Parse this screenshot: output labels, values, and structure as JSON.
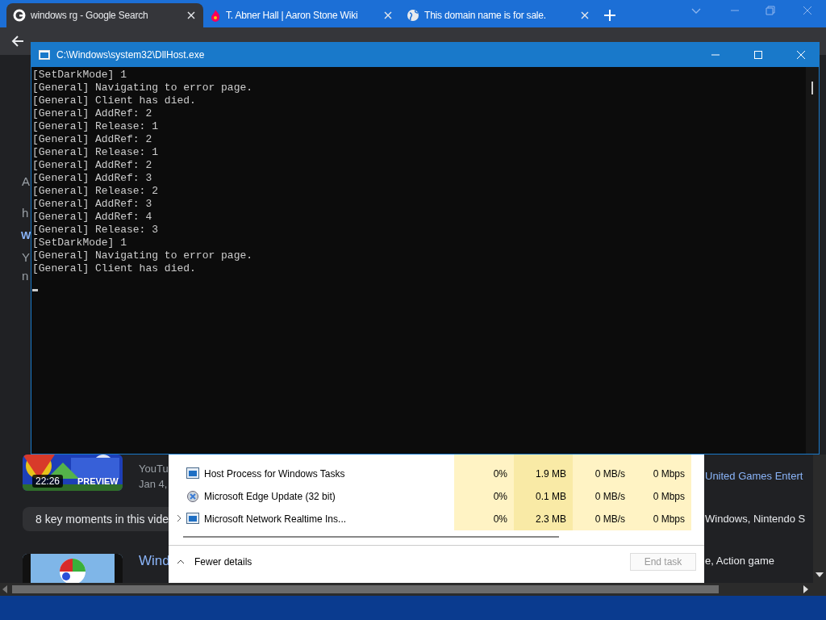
{
  "browser": {
    "tabs": [
      {
        "title": "windows rg - Google Search",
        "selected": true
      },
      {
        "title": "T. Abner Hall | Aaron Stone Wiki",
        "selected": false
      },
      {
        "title": "This domain name is for sale.",
        "selected": false
      }
    ],
    "page": {
      "left_fragments": [
        {
          "text": "A",
          "kind": "plain"
        },
        {
          "text": "h",
          "kind": "plain"
        },
        {
          "text": "W",
          "kind": "link"
        },
        {
          "text": "Y",
          "kind": "plain"
        },
        {
          "text": "n",
          "kind": "plain"
        }
      ],
      "video": {
        "duration": "22:26",
        "badge": "PREVIEW",
        "source": "YouTu",
        "date": "Jan 4,",
        "channel": "United Games Entert"
      },
      "key_moments": "8 key moments in this vide",
      "video_tags": "Windows, Nintendo S",
      "next_video": {
        "title": "Wind",
        "tags": "e, Action game"
      }
    }
  },
  "console": {
    "title": "C:\\Windows\\system32\\DllHost.exe",
    "lines": [
      "[SetDarkMode] 1",
      "[General] Navigating to error page.",
      "[General] Client has died.",
      "[General] AddRef: 2",
      "[General] Release: 1",
      "[General] AddRef: 2",
      "[General] Release: 1",
      "[General] AddRef: 2",
      "[General] AddRef: 3",
      "[General] Release: 2",
      "[General] AddRef: 3",
      "[General] AddRef: 4",
      "[General] Release: 3",
      "[SetDarkMode] 1",
      "[General] Navigating to error page.",
      "[General] Client has died."
    ]
  },
  "task_manager": {
    "rows": [
      {
        "name": "Host Process for Windows Tasks",
        "kind": "process",
        "cpu": "0%",
        "memory": "1.9 MB",
        "disk": "0 MB/s",
        "network": "0 Mbps"
      },
      {
        "name": "Microsoft Edge Update (32 bit)",
        "kind": "updater",
        "cpu": "0%",
        "memory": "0.1 MB",
        "disk": "0 MB/s",
        "network": "0 Mbps"
      },
      {
        "name": "Microsoft Network Realtime Ins...",
        "kind": "group",
        "cpu": "0%",
        "memory": "2.3 MB",
        "disk": "0 MB/s",
        "network": "0 Mbps"
      }
    ],
    "details_toggle": "Fewer details",
    "end_task": {
      "label": "End task",
      "disabled": true
    }
  }
}
